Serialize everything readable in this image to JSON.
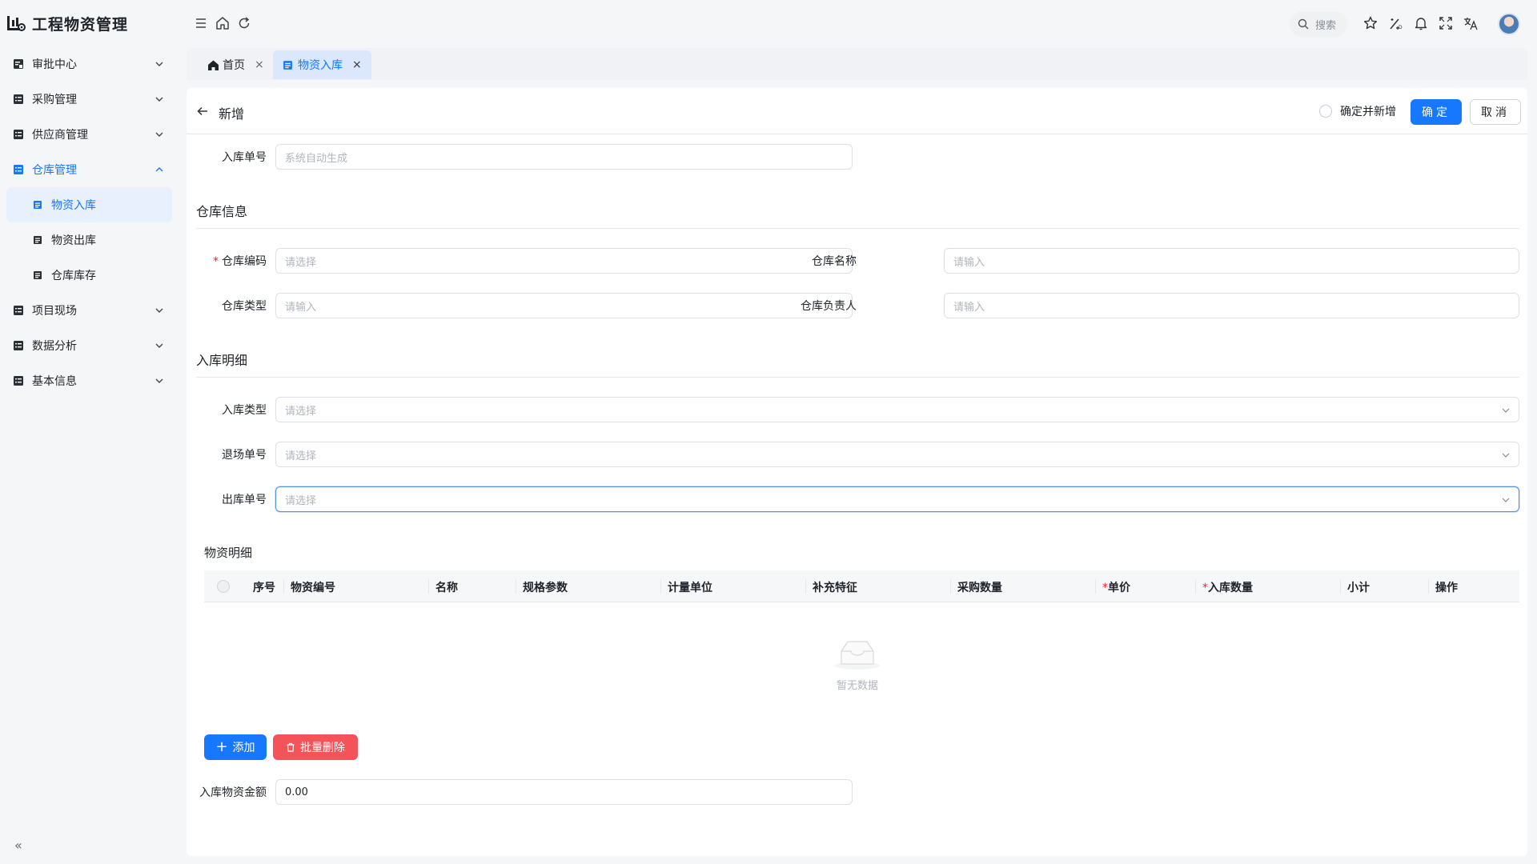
{
  "app": {
    "title": "工程物资管理"
  },
  "sidebar": {
    "items": [
      {
        "label": "审批中心"
      },
      {
        "label": "采购管理"
      },
      {
        "label": "供应商管理"
      },
      {
        "label": "仓库管理",
        "children": [
          {
            "label": "物资入库"
          },
          {
            "label": "物资出库"
          },
          {
            "label": "仓库库存"
          }
        ]
      },
      {
        "label": "项目现场"
      },
      {
        "label": "数据分析"
      },
      {
        "label": "基本信息"
      }
    ],
    "collapse_icon": "«"
  },
  "header": {
    "search_label": "搜索"
  },
  "tabs": [
    {
      "label": "首页",
      "close": "×"
    },
    {
      "label": "物资入库",
      "close": "×"
    }
  ],
  "page": {
    "title": "新增",
    "confirm_and_new": "确定并新增",
    "confirm": "确定",
    "cancel": "取消"
  },
  "form": {
    "receipt_no": {
      "label": "入库单号",
      "placeholder": "系统自动生成"
    },
    "warehouse_section": "仓库信息",
    "warehouse_code": {
      "label": "仓库编码",
      "placeholder": "请选择"
    },
    "warehouse_name": {
      "label": "仓库名称",
      "placeholder": "请输入"
    },
    "warehouse_type": {
      "label": "仓库类型",
      "placeholder": "请输入"
    },
    "warehouse_manager": {
      "label": "仓库负责人",
      "placeholder": "请输入"
    },
    "detail_section": "入库明细",
    "receipt_type": {
      "label": "入库类型",
      "placeholder": "请选择"
    },
    "exit_no": {
      "label": "退场单号",
      "placeholder": "请选择"
    },
    "outbound_no": {
      "label": "出库单号",
      "placeholder": "请选择"
    },
    "amount": {
      "label": "入库物资金额",
      "value": "0.00"
    }
  },
  "table": {
    "title": "物资明细",
    "columns": [
      "序号",
      "物资编号",
      "名称",
      "规格参数",
      "计量单位",
      "补充特征",
      "采购数量",
      "单价",
      "入库数量",
      "小计",
      "操作"
    ],
    "empty_text": "暂无数据",
    "add_button": "添加",
    "batch_delete_button": "批量删除"
  },
  "colors": {
    "primary": "#1677ff",
    "danger": "#f5535a",
    "active_bg": "#e8f0fd"
  }
}
